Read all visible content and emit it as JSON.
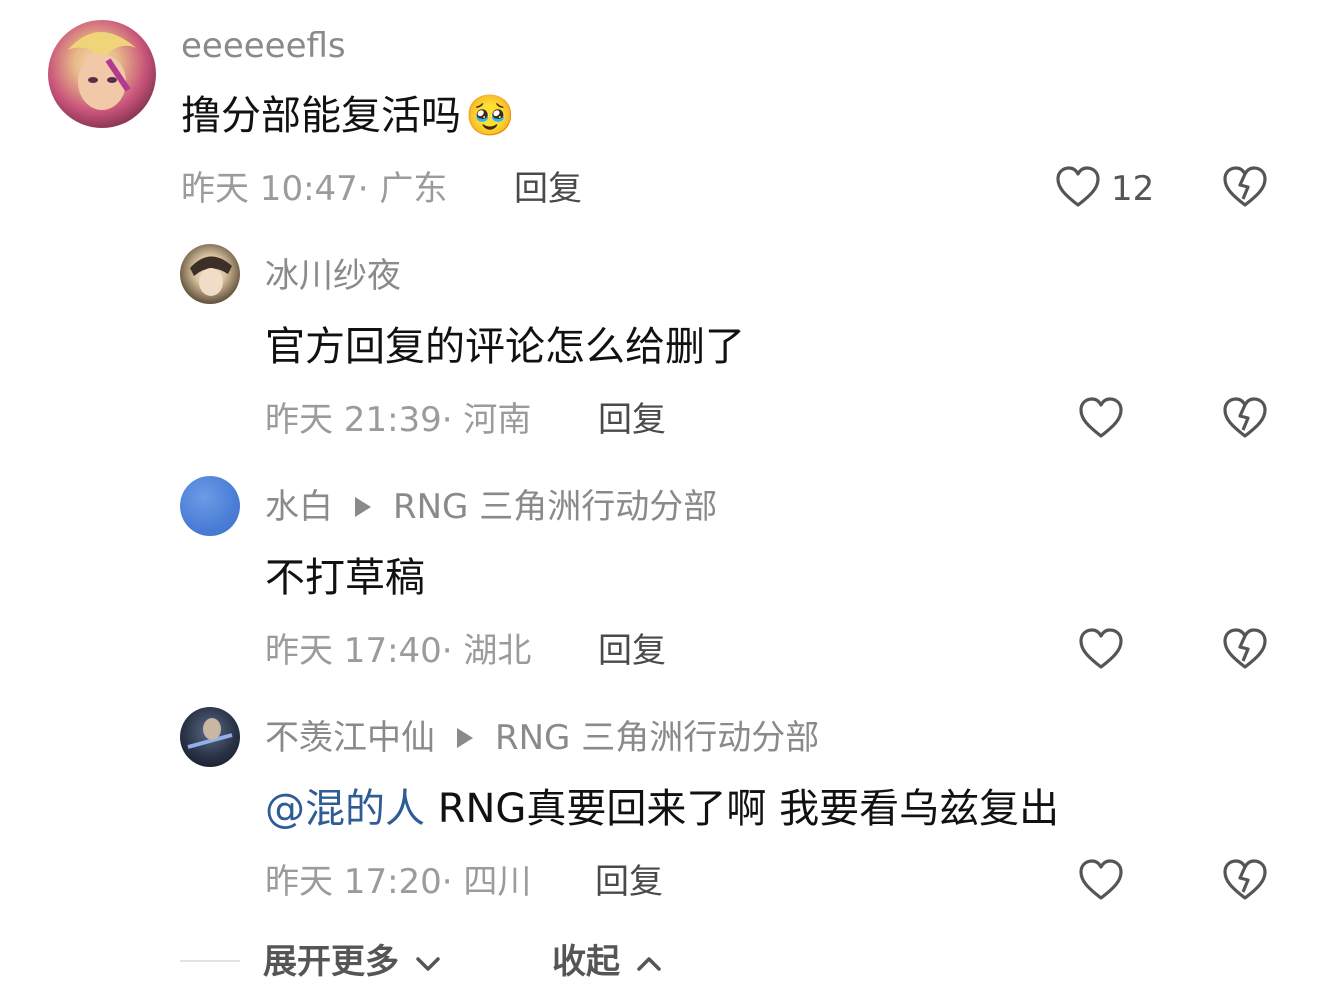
{
  "main_comment": {
    "username": "eeeeeefls",
    "text": "撸分部能复活吗",
    "emoji": "🥹",
    "time": "昨天 10:47",
    "location": "广东",
    "reply_label": "回复",
    "like_count": "12"
  },
  "replies": [
    {
      "username": "冰川纱夜",
      "reply_to": "",
      "text": "官方回复的评论怎么给删了",
      "time": "昨天 21:39",
      "location": "河南",
      "reply_label": "回复"
    },
    {
      "username": "水白",
      "reply_to": "RNG 三角洲行动分部",
      "text": "不打草稿",
      "time": "昨天 17:40",
      "location": "湖北",
      "reply_label": "回复"
    },
    {
      "username": "不羡江中仙",
      "reply_to": "RNG 三角洲行动分部",
      "mention": "@混的人",
      "text": " RNG真要回来了啊 我要看乌兹复出",
      "time": "昨天 17:20",
      "location": "四川",
      "reply_label": "回复"
    }
  ],
  "footer": {
    "expand_label": "展开更多",
    "collapse_label": "收起"
  },
  "icons": {
    "like": "heart-outline-icon",
    "dislike": "broken-heart-icon",
    "expand": "chevron-down-icon",
    "collapse": "chevron-up-icon",
    "reply_to": "play-triangle-icon"
  },
  "colors": {
    "mention": "#2f5c97",
    "meta": "#9b9b9b",
    "username": "#8a8a8a",
    "text": "#111111"
  }
}
